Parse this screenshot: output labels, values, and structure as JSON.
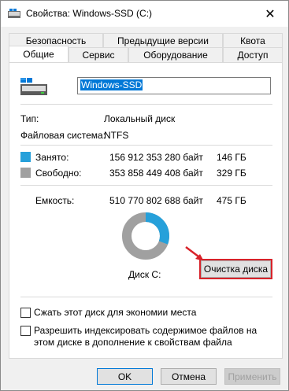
{
  "window": {
    "title": "Свойства: Windows-SSD (C:)",
    "close_glyph": "✕"
  },
  "tabs": {
    "upper": [
      "Безопасность",
      "Предыдущие версии",
      "Квота"
    ],
    "lower": [
      "Общие",
      "Сервис",
      "Оборудование",
      "Доступ"
    ],
    "active": "Общие"
  },
  "general": {
    "volume_name": "Windows-SSD",
    "type_label": "Тип:",
    "type_value": "Локальный диск",
    "fs_label": "Файловая система:",
    "fs_value": "NTFS",
    "used_label": "Занято:",
    "used_bytes": "156 912 353 280 байт",
    "used_gb": "146 ГБ",
    "free_label": "Свободно:",
    "free_bytes": "353 858 449 408 байт",
    "free_gb": "329 ГБ",
    "capacity_label": "Емкость:",
    "capacity_bytes": "510 770 802 688 байт",
    "capacity_gb": "475 ГБ",
    "disk_label": "Диск C:",
    "cleanup_button": "Очистка диска",
    "used_fraction": 0.307,
    "used_color": "#26a0da",
    "free_color": "#a0a0a0",
    "compress_label": "Сжать этот диск для экономии места",
    "index_label": "Разрешить индексировать содержимое файлов на этом диске в дополнение к свойствам файла"
  },
  "buttons": {
    "ok": "OK",
    "cancel": "Отмена",
    "apply": "Применить"
  },
  "colors": {
    "accent": "#0078d7",
    "highlight": "#d8232a"
  }
}
